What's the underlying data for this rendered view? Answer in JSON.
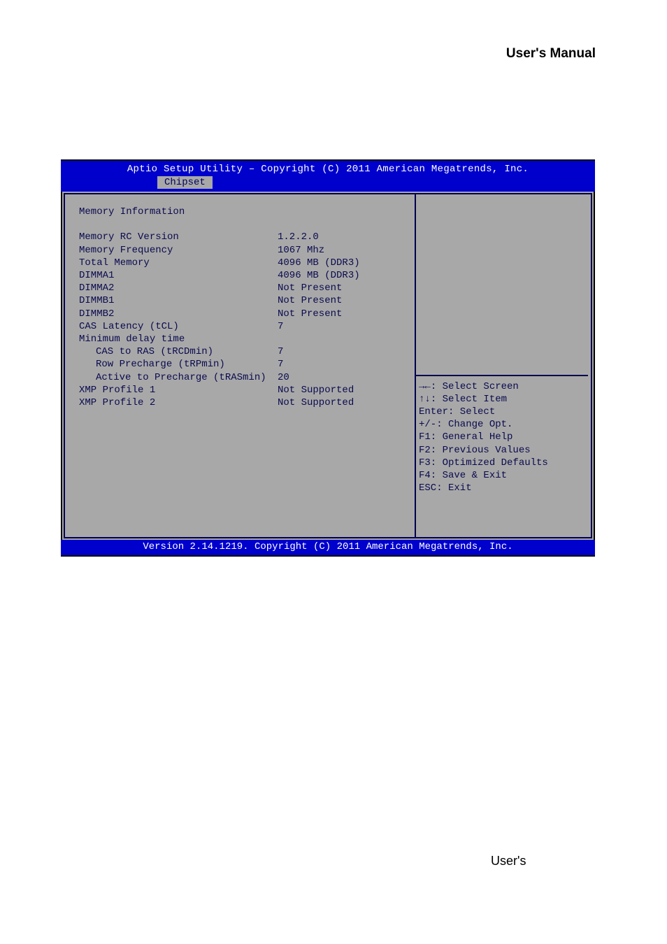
{
  "page": {
    "header": "User's  Manual",
    "footer": "User's"
  },
  "bios": {
    "title": "Aptio Setup Utility – Copyright (C) 2011 American Megatrends, Inc.",
    "tab": "Chipset",
    "section_title": "Memory Information",
    "rows": [
      {
        "label": "Memory RC Version",
        "value": "1.2.2.0"
      },
      {
        "label": "Memory Frequency",
        "value": "1067 Mhz"
      },
      {
        "label": "Total Memory",
        "value": "4096 MB (DDR3)"
      },
      {
        "label": "DIMMA1",
        "value": "4096 MB (DDR3)"
      },
      {
        "label": "DIMMA2",
        "value": "Not Present"
      },
      {
        "label": "DIMMB1",
        "value": "Not Present"
      },
      {
        "label": "DIMMB2",
        "value": "Not Present"
      },
      {
        "label": "CAS Latency (tCL)",
        "value": "7"
      }
    ],
    "min_delay_label": "Minimum delay time",
    "subrows": [
      {
        "label": "CAS to RAS (tRCDmin)",
        "value": "7"
      },
      {
        "label": "Row Precharge (tRPmin)",
        "value": "7"
      },
      {
        "label": "Active to Precharge (tRASmin)",
        "value": "20"
      }
    ],
    "xmp": [
      {
        "label": "XMP Profile 1",
        "value": "Not Supported"
      },
      {
        "label": "XMP Profile 2",
        "value": "Not Supported"
      }
    ],
    "help": {
      "l1a": "→←",
      "l1b": ": Select Screen",
      "l2a": "↑↓",
      "l2b": ": Select Item",
      "l3": "Enter: Select",
      "l4": "+/-: Change Opt.",
      "l5": "F1: General Help",
      "l6": "F2: Previous Values",
      "l7": "F3: Optimized Defaults",
      "l8": "F4: Save & Exit",
      "l9": "ESC: Exit"
    },
    "footer": "Version 2.14.1219. Copyright (C) 2011 American Megatrends, Inc."
  }
}
